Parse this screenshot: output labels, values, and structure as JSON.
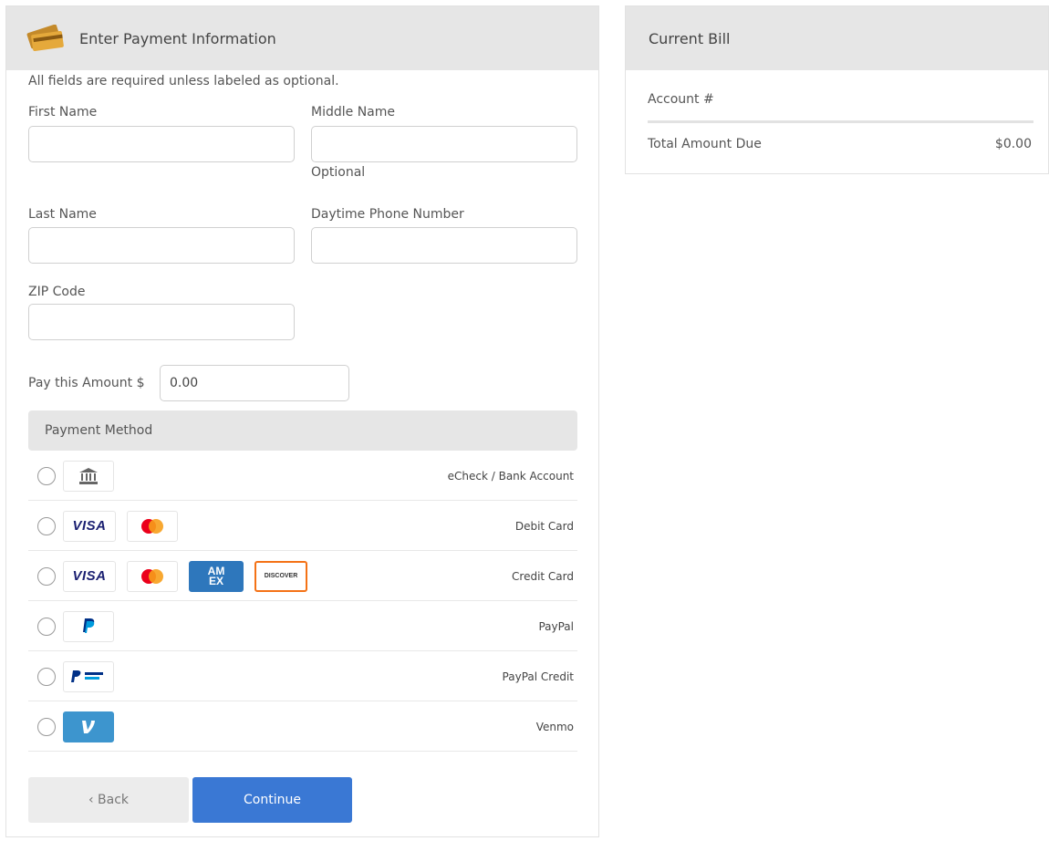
{
  "payment_panel": {
    "title": "Enter Payment Information",
    "note": "All fields are required unless labeled as optional.",
    "fields": {
      "first_name": {
        "label": "First Name",
        "value": ""
      },
      "middle_name": {
        "label": "Middle Name",
        "value": "",
        "hint": "Optional"
      },
      "last_name": {
        "label": "Last Name",
        "value": ""
      },
      "phone": {
        "label": "Daytime Phone Number",
        "value": ""
      },
      "zip": {
        "label": "ZIP Code",
        "value": ""
      }
    },
    "amount": {
      "label": "Pay this Amount $",
      "value": "0.00"
    },
    "payment_method": {
      "title": "Payment Method",
      "options": [
        {
          "label": "eCheck / Bank Account",
          "icons": [
            "bank-icon"
          ],
          "selected": false
        },
        {
          "label": "Debit Card",
          "icons": [
            "visa-icon",
            "mastercard-icon"
          ],
          "selected": false
        },
        {
          "label": "Credit Card",
          "icons": [
            "visa-icon",
            "mastercard-icon",
            "amex-icon",
            "discover-icon"
          ],
          "selected": false
        },
        {
          "label": "PayPal",
          "icons": [
            "paypal-icon"
          ],
          "selected": false
        },
        {
          "label": "PayPal Credit",
          "icons": [
            "paypal-credit-icon"
          ],
          "selected": false
        },
        {
          "label": "Venmo",
          "icons": [
            "venmo-icon"
          ],
          "selected": false
        }
      ]
    },
    "buttons": {
      "back": "‹ Back",
      "continue": "Continue"
    }
  },
  "bill_panel": {
    "title": "Current Bill",
    "account_label": "Account #",
    "account_value": "",
    "total_label": "Total Amount Due",
    "total_value": "$0.00"
  },
  "logo_text": {
    "visa": "VISA",
    "amex": "AM EX",
    "discover": "DISCOVER"
  },
  "colors": {
    "header_bg": "#e6e6e6",
    "continue_bg": "#3a78d4",
    "back_bg": "#ececec",
    "venmo": "#3d95ce"
  }
}
